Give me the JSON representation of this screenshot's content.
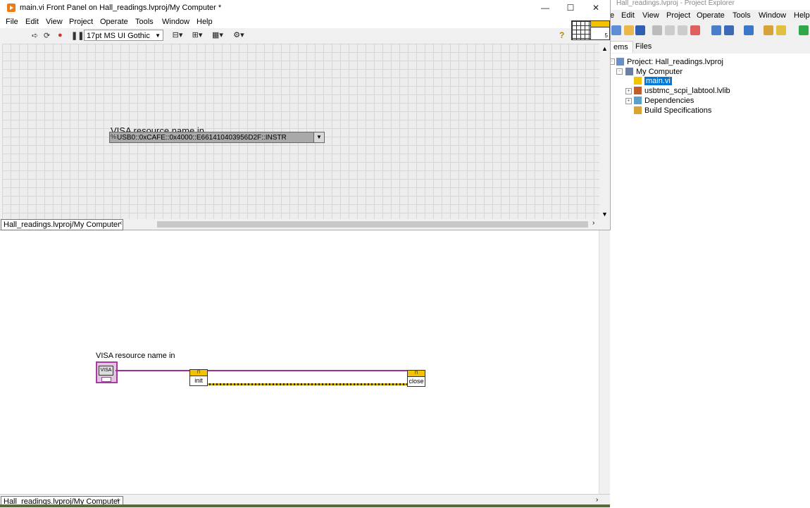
{
  "front_panel": {
    "title": "main.vi Front Panel on Hall_readings.lvproj/My Computer *",
    "menu": [
      "File",
      "Edit",
      "View",
      "Project",
      "Operate",
      "Tools",
      "Window",
      "Help"
    ],
    "font": "17pt MS UI Gothic",
    "controls": {
      "visa_label": "VISA resource name in",
      "visa_prefix": "%",
      "visa_value": "USB0::0xCAFE::0x4000::E661410403956D2F::INSTR"
    },
    "context": "Hall_readings.lvproj/My Computer",
    "icon_number": "5"
  },
  "block_diagram": {
    "visa_label": "VISA resource name in",
    "visa_terminal": "VISA",
    "subvi_init": "init",
    "subvi_close": "close",
    "subvi_badge": "⊓",
    "context": "Hall_readings.lvproj/My Computer"
  },
  "project_explorer": {
    "title": "Hall_readings.lvproj - Project Explorer",
    "menu": [
      "e",
      "Edit",
      "View",
      "Project",
      "Operate",
      "Tools",
      "Window",
      "Help"
    ],
    "tabs": [
      "ems",
      "Files"
    ],
    "tree": {
      "project": "Project: Hall_readings.lvproj",
      "computer": "My Computer",
      "main_vi": "main.vi",
      "lib": "usbtmc_scpi_labtool.lvlib",
      "deps": "Dependencies",
      "build": "Build Specifications"
    }
  },
  "colors": {
    "visa_wire": "#9b2f96",
    "error_wire": "#c8a800",
    "selection": "#0078d7",
    "labview_orange": "#f07c0f"
  }
}
